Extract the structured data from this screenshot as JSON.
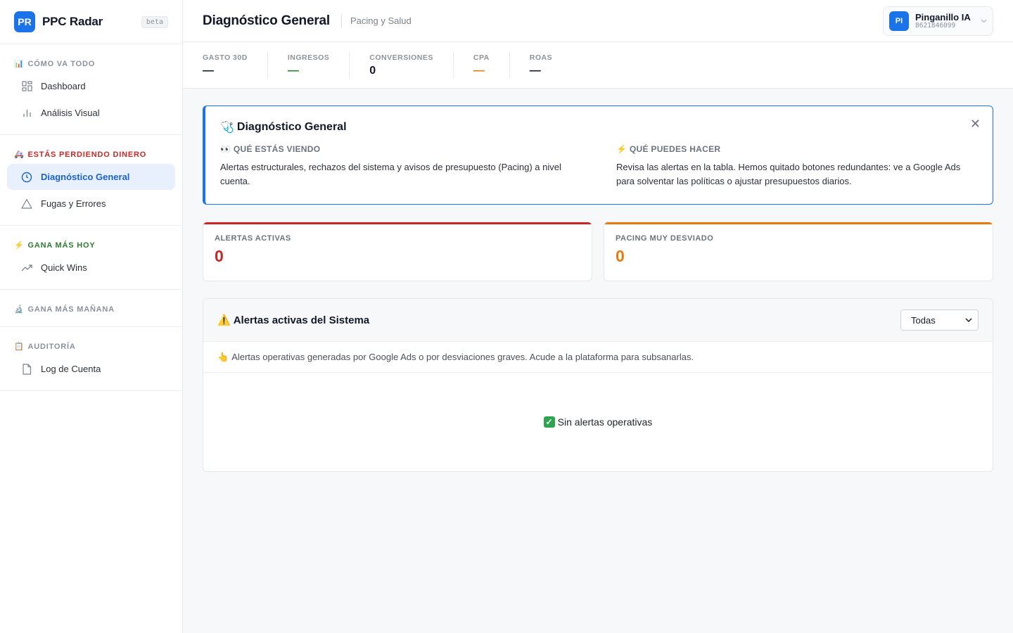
{
  "brand": {
    "logo": "PR",
    "name": "PPC Radar",
    "badge": "beta"
  },
  "sidebar": {
    "sections": [
      {
        "emoji": "📊",
        "title": "CÓMO VA TODO",
        "color": "#8b929c",
        "items": [
          {
            "label": "Dashboard",
            "icon": "grid-icon"
          },
          {
            "label": "Análisis Visual",
            "icon": "bar-chart-icon"
          }
        ]
      },
      {
        "emoji": "🚑",
        "title": "ESTÁS PERDIENDO DINERO",
        "color": "#c62828",
        "items": [
          {
            "label": "Diagnóstico General",
            "icon": "clock-icon",
            "active": true
          },
          {
            "label": "Fugas y Errores",
            "icon": "warning-triangle-icon"
          }
        ]
      },
      {
        "emoji": "⚡",
        "title": "GANA MÁS HOY",
        "color": "#2e7d32",
        "items": [
          {
            "label": "Quick Wins",
            "icon": "trending-up-icon"
          }
        ]
      },
      {
        "emoji": "🔬",
        "title": "GANA MÁS MAÑANA",
        "color": "#8b929c",
        "items": []
      },
      {
        "emoji": "📋",
        "title": "AUDITORÍA",
        "color": "#8b929c",
        "items": [
          {
            "label": "Log de Cuenta",
            "icon": "file-icon"
          }
        ]
      }
    ]
  },
  "header": {
    "title": "Diagnóstico General",
    "subtitle": "Pacing y Salud"
  },
  "account": {
    "initials": "PI",
    "name": "Pinganillo IA",
    "id": "8621846099"
  },
  "kpis": [
    {
      "label": "GASTO 30D",
      "value": "—"
    },
    {
      "label": "INGRESOS",
      "value": "—"
    },
    {
      "label": "CONVERSIONES",
      "value": "0"
    },
    {
      "label": "CPA",
      "value": "—"
    },
    {
      "label": "ROAS",
      "value": "—"
    }
  ],
  "info": {
    "emoji": "🩺",
    "title": "Diagnóstico General",
    "close": "✕",
    "left_title": "👀 QUÉ ESTÁS VIENDO",
    "left_text": "Alertas estructurales, rechazos del sistema y avisos de presupuesto (Pacing) a nivel cuenta.",
    "right_title": "⚡ QUÉ PUEDES HACER",
    "right_text": "Revisa las alertas en la tabla. Hemos quitado botones redundantes: ve a Google Ads para solventar las políticas o ajustar presupuestos diarios."
  },
  "stats": [
    {
      "label": "ALERTAS ACTIVAS",
      "value": "0",
      "color": "#c62828"
    },
    {
      "label": "PACING MUY DESVIADO",
      "value": "0",
      "color": "#e67c0f"
    }
  ],
  "alerts": {
    "emoji": "⚠️",
    "title": "Alertas activas del Sistema",
    "filter": {
      "selected": "Todas"
    },
    "note_emoji": "👆",
    "note": "Alertas operativas generadas por Google Ads o por desviaciones graves. Acude a la plataforma para subsanarlas.",
    "empty": "Sin alertas operativas"
  }
}
